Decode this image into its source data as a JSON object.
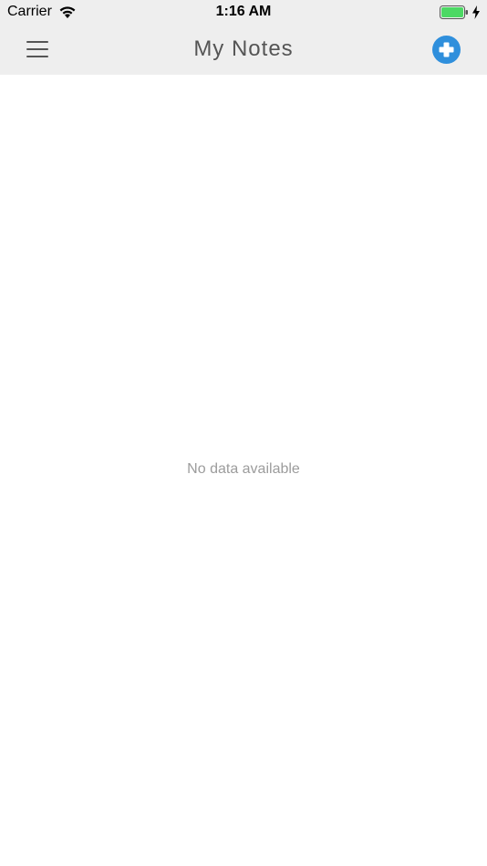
{
  "status_bar": {
    "carrier": "Carrier",
    "time": "1:16 AM",
    "wifi_icon": "wifi-icon",
    "battery_icon": "battery-icon",
    "charging_icon": "charging-bolt-icon",
    "battery_color": "#4cd964"
  },
  "nav_bar": {
    "title": "My Notes",
    "menu_icon": "hamburger-menu-icon",
    "add_icon": "plus-circle-icon",
    "accent_color": "#2f8fdc"
  },
  "content": {
    "empty_message": "No data available"
  }
}
